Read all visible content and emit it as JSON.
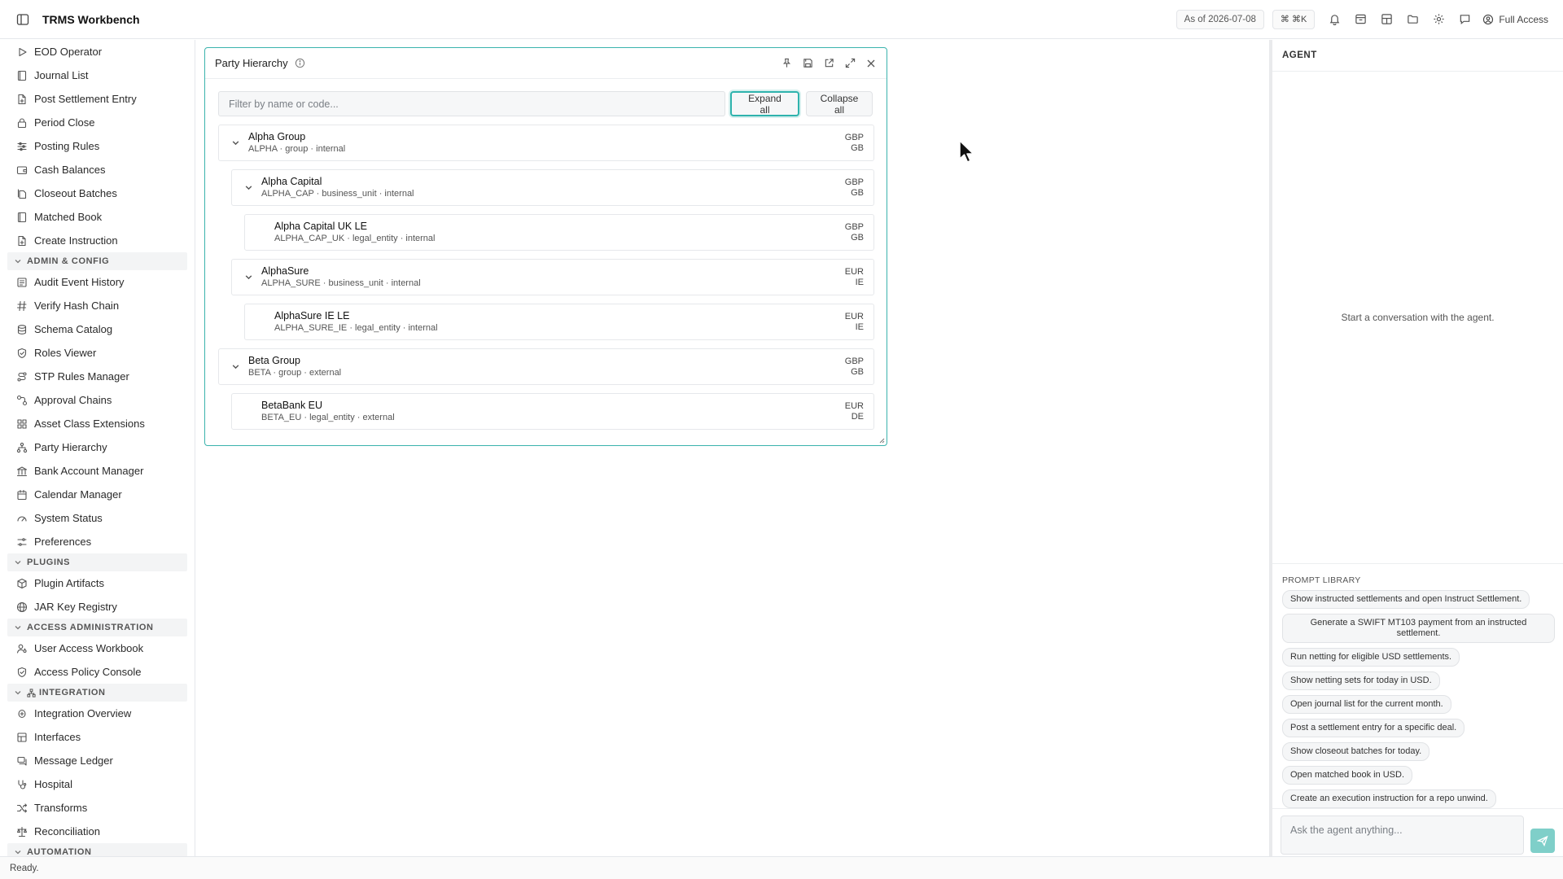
{
  "app": {
    "title": "TRMS Workbench",
    "as_of": "As of 2026-07-08",
    "shortcut": "⌘ ⌘K",
    "access": "Full Access"
  },
  "sidebar": {
    "items_top": [
      {
        "label": "EOD Operator",
        "icon": "play-icon"
      },
      {
        "label": "Journal List",
        "icon": "book-icon"
      },
      {
        "label": "Post Settlement Entry",
        "icon": "file-plus-icon"
      },
      {
        "label": "Period Close",
        "icon": "lock-icon"
      },
      {
        "label": "Posting Rules",
        "icon": "sliders-icon"
      },
      {
        "label": "Cash Balances",
        "icon": "wallet-icon"
      },
      {
        "label": "Closeout Batches",
        "icon": "files-icon"
      },
      {
        "label": "Matched Book",
        "icon": "book-icon"
      },
      {
        "label": "Create Instruction",
        "icon": "file-plus-icon"
      }
    ],
    "section_admin": "ADMIN & CONFIG",
    "items_admin": [
      {
        "label": "Audit Event History",
        "icon": "history-icon"
      },
      {
        "label": "Verify Hash Chain",
        "icon": "hash-icon"
      },
      {
        "label": "Schema Catalog",
        "icon": "database-icon"
      },
      {
        "label": "Roles Viewer",
        "icon": "shield-icon"
      },
      {
        "label": "STP Rules Manager",
        "icon": "route-icon"
      },
      {
        "label": "Approval Chains",
        "icon": "chain-icon"
      },
      {
        "label": "Asset Class Extensions",
        "icon": "blocks-icon"
      },
      {
        "label": "Party Hierarchy",
        "icon": "network-icon"
      },
      {
        "label": "Bank Account Manager",
        "icon": "bank-icon"
      },
      {
        "label": "Calendar Manager",
        "icon": "calendar-icon"
      },
      {
        "label": "System Status",
        "icon": "gauge-icon"
      },
      {
        "label": "Preferences",
        "icon": "settings-icon"
      }
    ],
    "section_plugins": "PLUGINS",
    "items_plugins": [
      {
        "label": "Plugin Artifacts",
        "icon": "package-icon"
      },
      {
        "label": "JAR Key Registry",
        "icon": "globe-icon"
      }
    ],
    "section_access": "ACCESS ADMINISTRATION",
    "items_access": [
      {
        "label": "User Access Workbook",
        "icon": "user-key-icon"
      },
      {
        "label": "Access Policy Console",
        "icon": "shield-icon"
      }
    ],
    "section_integration": "INTEGRATION",
    "items_integration": [
      {
        "label": "Integration Overview",
        "icon": "plug-icon"
      },
      {
        "label": "Interfaces",
        "icon": "layers-icon"
      },
      {
        "label": "Message Ledger",
        "icon": "messages-icon"
      },
      {
        "label": "Hospital",
        "icon": "stethoscope-icon"
      },
      {
        "label": "Transforms",
        "icon": "shuffle-icon"
      },
      {
        "label": "Reconciliation",
        "icon": "scale-icon"
      }
    ],
    "section_automation": "AUTOMATION"
  },
  "panel": {
    "title": "Party Hierarchy",
    "filter_placeholder": "Filter by name or code...",
    "expand_all": "Expand all",
    "collapse_all": "Collapse all",
    "nodes": [
      {
        "name": "Alpha Group",
        "meta": "ALPHA · group · internal",
        "ccy": "GBP",
        "country": "GB",
        "level": 0,
        "expandable": true
      },
      {
        "name": "Alpha Capital",
        "meta": "ALPHA_CAP · business_unit · internal",
        "ccy": "GBP",
        "country": "GB",
        "level": 1,
        "expandable": true
      },
      {
        "name": "Alpha Capital UK LE",
        "meta": "ALPHA_CAP_UK · legal_entity · internal",
        "ccy": "GBP",
        "country": "GB",
        "level": 2,
        "expandable": false
      },
      {
        "name": "AlphaSure",
        "meta": "ALPHA_SURE · business_unit · internal",
        "ccy": "EUR",
        "country": "IE",
        "level": 1,
        "expandable": true
      },
      {
        "name": "AlphaSure IE LE",
        "meta": "ALPHA_SURE_IE · legal_entity · internal",
        "ccy": "EUR",
        "country": "IE",
        "level": 2,
        "expandable": false
      },
      {
        "name": "Beta Group",
        "meta": "BETA · group · external",
        "ccy": "GBP",
        "country": "GB",
        "level": 0,
        "expandable": true
      },
      {
        "name": "BetaBank EU",
        "meta": "BETA_EU · legal_entity · external",
        "ccy": "EUR",
        "country": "DE",
        "level": 1,
        "expandable": false
      }
    ]
  },
  "agent": {
    "title": "AGENT",
    "empty_text": "Start a conversation with the agent.",
    "prompt_library_title": "PROMPT LIBRARY",
    "prompts": [
      "Show instructed settlements and open Instruct Settlement.",
      "Generate a SWIFT MT103 payment from an instructed settlement.",
      "Run netting for eligible USD settlements.",
      "Show netting sets for today in USD.",
      "Open journal list for the current month.",
      "Post a settlement entry for a specific deal.",
      "Show closeout batches for today.",
      "Open matched book in USD.",
      "Create an execution instruction for a repo unwind."
    ],
    "input_placeholder": "Ask the agent anything..."
  },
  "status": {
    "text": "Ready."
  },
  "colors": {
    "accent": "#3bb3ad",
    "send_button": "#7fcfc9"
  }
}
